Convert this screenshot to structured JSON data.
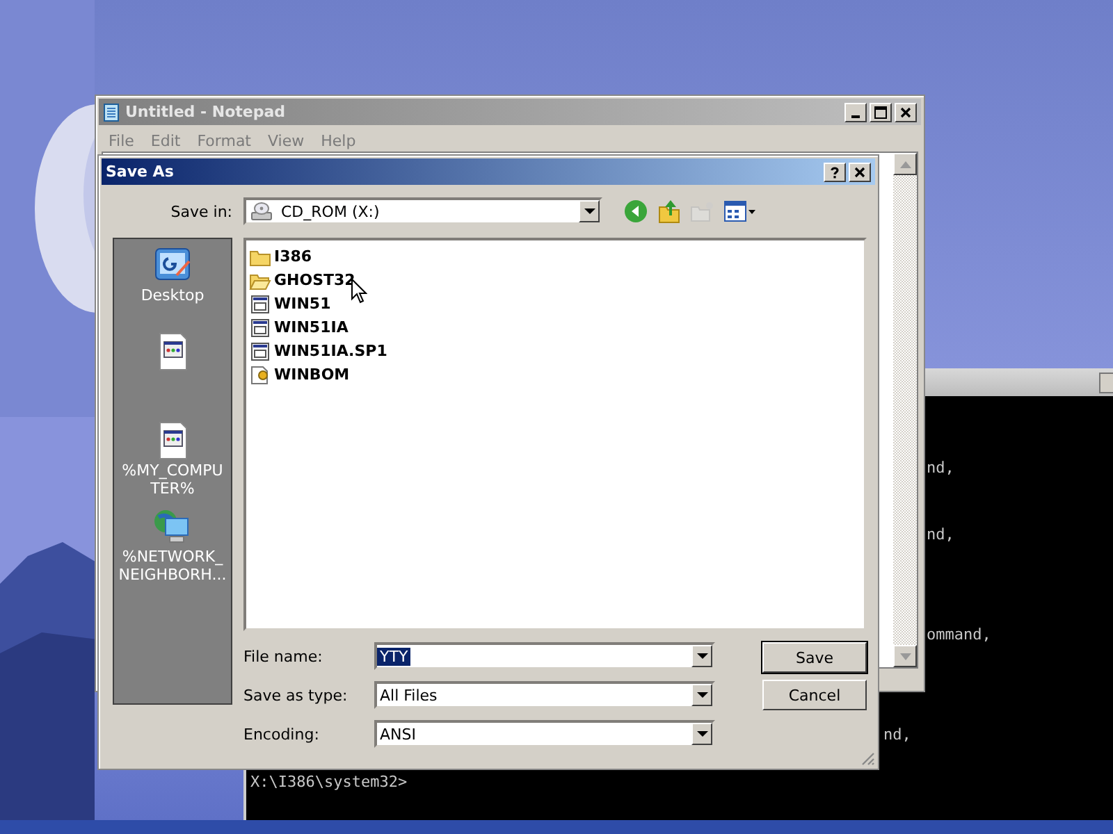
{
  "notepad": {
    "title": "Untitled - Notepad",
    "active": false,
    "menu": [
      "File",
      "Edit",
      "Format",
      "View",
      "Help"
    ]
  },
  "console": {
    "lines": [
      {
        "text": "nd,"
      },
      {
        "text": "nd,"
      },
      {
        "text": "ommand,"
      },
      {
        "text": "nd,"
      },
      {
        "text": "X:\\I386\\system32>"
      }
    ]
  },
  "dialog": {
    "title": "Save As",
    "active": true,
    "save_in": {
      "label": "Save in:",
      "value": "CD_ROM (X:)"
    },
    "toolbar": [
      {
        "kind": "back",
        "disabled": false
      },
      {
        "kind": "up",
        "disabled": false
      },
      {
        "kind": "new-folder",
        "disabled": true
      },
      {
        "kind": "views",
        "disabled": false
      }
    ],
    "places": [
      {
        "kind": "desktop",
        "label": "Desktop"
      },
      {
        "kind": "document"
      },
      {
        "kind": "document",
        "label": "%MY_COMPUTER%"
      },
      {
        "kind": "network",
        "label": "%NETWORK_NEIGHBORH..."
      }
    ],
    "files": [
      {
        "kind": "folder",
        "name": "I386"
      },
      {
        "kind": "open-folder",
        "name": "GHOST32"
      },
      {
        "kind": "app-file",
        "name": "WIN51"
      },
      {
        "kind": "app-file",
        "name": "WIN51IA"
      },
      {
        "kind": "app-file",
        "name": "WIN51IA.SP1"
      },
      {
        "kind": "settings-file",
        "name": "WINBOM"
      }
    ],
    "fields": [
      {
        "label": "File name:",
        "value": "YTY",
        "highlighted": true
      },
      {
        "label": "Save as type:",
        "value": "All Files",
        "highlighted": false
      },
      {
        "label": "Encoding:",
        "value": "ANSI",
        "highlighted": false
      }
    ],
    "buttons": [
      "Save",
      "Cancel"
    ]
  }
}
